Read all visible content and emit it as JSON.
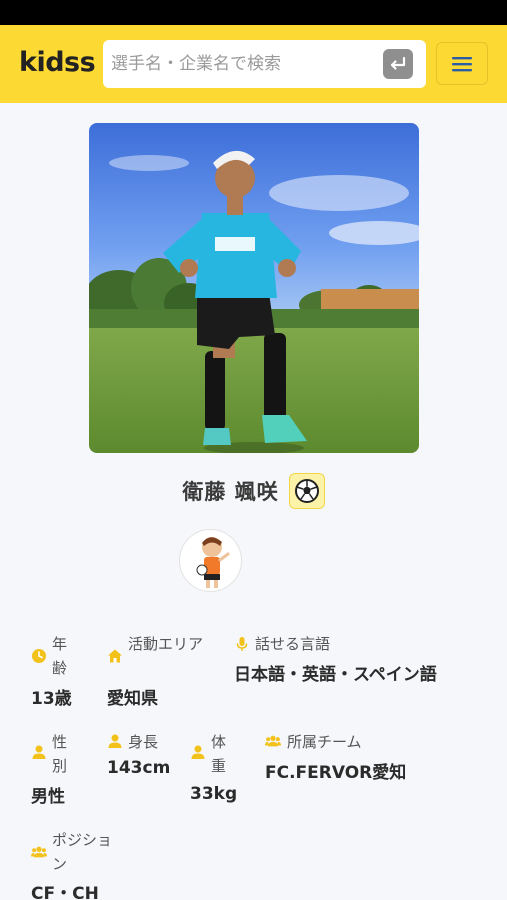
{
  "header": {
    "logo": "kidss",
    "search_placeholder": "選手名・企業名で検索",
    "search_value": "",
    "accent_color": "#fcd933"
  },
  "profile": {
    "name": "衛藤 颯咲",
    "sport_icon": "soccer-ball-icon",
    "photo_alt": "衛藤 颯咲"
  },
  "info": {
    "age": {
      "label": "年齢",
      "value": "13歳",
      "icon": "clock-icon"
    },
    "area": {
      "label": "活動エリア",
      "value": "愛知県",
      "icon": "home-icon"
    },
    "language": {
      "label": "話せる言語",
      "value": "日本語・英語・スペイン語",
      "icon": "microphone-icon"
    },
    "gender": {
      "label": "性別",
      "value": "男性",
      "icon": "person-icon"
    },
    "height": {
      "label": "身長",
      "value": "143cm",
      "icon": "person-icon"
    },
    "weight": {
      "label": "体重",
      "value": "33kg",
      "icon": "person-icon"
    },
    "team": {
      "label": "所属チーム",
      "value": "FC.FERVOR愛知",
      "icon": "group-icon"
    },
    "position": {
      "label": "ポジション",
      "value": "CF・CH",
      "icon": "group-icon"
    }
  }
}
